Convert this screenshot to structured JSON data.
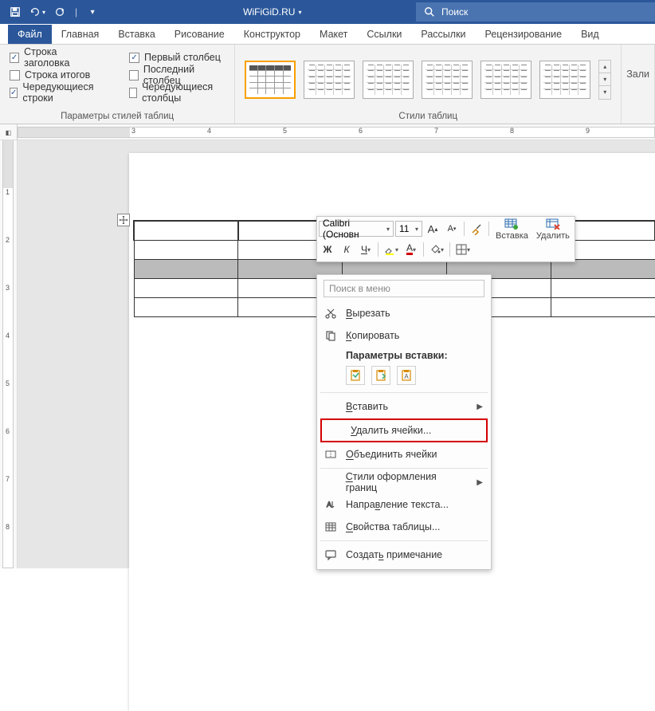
{
  "titlebar": {
    "doc_name": "WiFiGiD.RU",
    "search_placeholder": "Поиск"
  },
  "tabs": {
    "file": "Файл",
    "home": "Главная",
    "insert": "Вставка",
    "draw": "Рисование",
    "designer": "Конструктор",
    "layout": "Макет",
    "references": "Ссылки",
    "mailings": "Рассылки",
    "review": "Рецензирование",
    "view": "Вид"
  },
  "style_opts": {
    "header_row": "Строка заголовка",
    "total_row": "Строка итогов",
    "banded_rows": "Чередующиеся строки",
    "first_col": "Первый столбец",
    "last_col": "Последний столбец",
    "banded_cols": "Чередующиеся столбцы",
    "group_title": "Параметры стилей таблиц"
  },
  "styles": {
    "group_title": "Стили таблиц",
    "fill_stub": "Зали"
  },
  "minitool": {
    "font": "Calibri (Основн",
    "size": "11",
    "insert": "Вставка",
    "delete": "Удалить",
    "bold": "Ж",
    "italic": "К"
  },
  "ctx": {
    "search": "Поиск в меню",
    "cut": "Вырезать",
    "copy": "Копировать",
    "paste_header": "Параметры вставки:",
    "insert": "Вставить",
    "delete_cells": "Удалить ячейки...",
    "merge": "Объединить ячейки",
    "border_styles": "Стили оформления границ",
    "text_dir": "Направление текста...",
    "table_props": "Свойства таблицы...",
    "new_comment": "Создать примечание"
  },
  "ruler": {
    "h": [
      "3",
      "4",
      "5",
      "6",
      "7",
      "8",
      "9"
    ],
    "v": [
      "1",
      "2",
      "3",
      "4",
      "5",
      "6",
      "7",
      "8"
    ]
  }
}
